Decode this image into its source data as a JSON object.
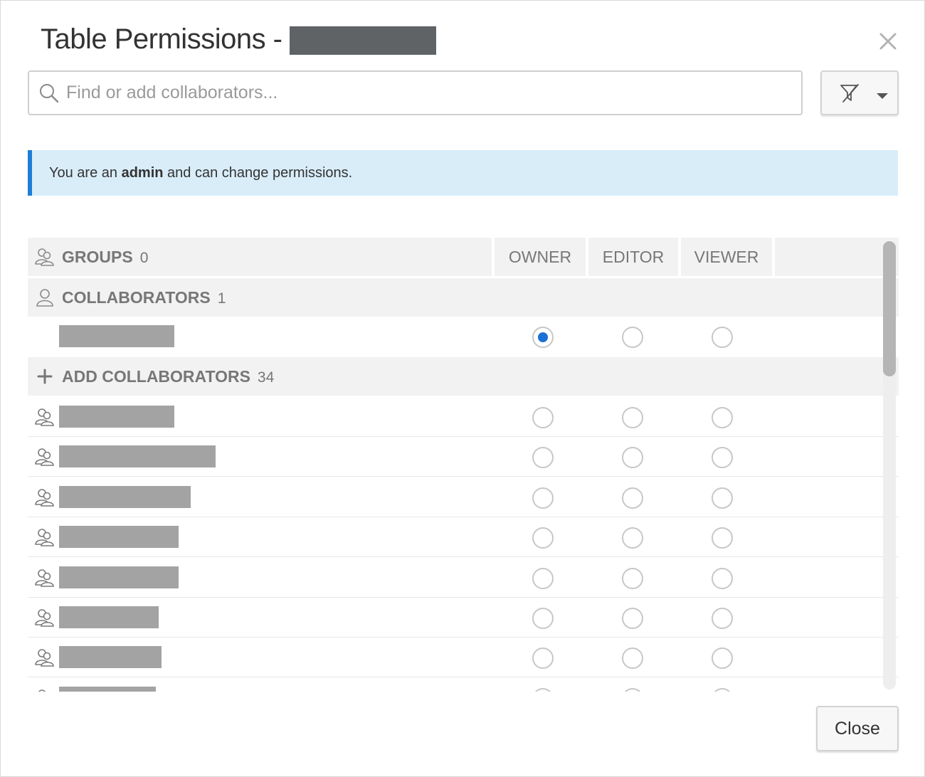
{
  "dialog": {
    "title": "Table Permissions -",
    "close_icon": "close-icon"
  },
  "search": {
    "placeholder": "Find or add collaborators...",
    "value": "",
    "icon": "search-icon"
  },
  "filter": {
    "icon": "filter-off-icon",
    "dropdown_icon": "caret-down-icon"
  },
  "notice": {
    "prefix": "You are an ",
    "bold": "admin",
    "suffix": " and can change permissions.",
    "accent_color": "#1c7ed6",
    "background": "#d9edf9"
  },
  "table": {
    "columns": [
      "OWNER",
      "EDITOR",
      "VIEWER"
    ],
    "groups": {
      "label": "GROUPS",
      "count": "0",
      "icon": "group-icon"
    },
    "collaborators": {
      "label": "COLLABORATORS",
      "count": "1",
      "icon": "user-icon",
      "rows": [
        {
          "selected": "owner"
        }
      ]
    },
    "add_collaborators": {
      "label": "ADD COLLABORATORS",
      "count": "34",
      "icon": "plus-icon",
      "row_icon": "group-icon",
      "visible_rows": 8
    }
  },
  "footer": {
    "close_label": "Close"
  },
  "colors": {
    "selected_radio": "#1c6fd6",
    "redaction": "#a3a3a3",
    "title_redaction": "#5f6366"
  }
}
